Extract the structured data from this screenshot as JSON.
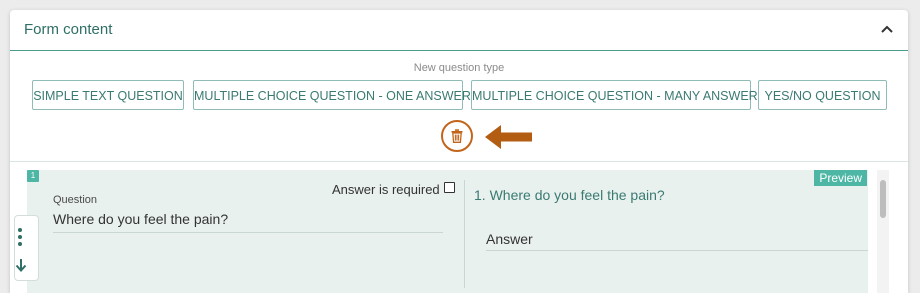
{
  "card": {
    "title": "Form content",
    "collapse_icon": "chevron-up-icon"
  },
  "new_question_type": {
    "label": "New question type",
    "buttons": [
      "SIMPLE TEXT QUESTION",
      "MULTIPLE CHOICE QUESTION - ONE ANSWER",
      "MULTIPLE CHOICE QUESTION - MANY ANSWERS",
      "YES/NO QUESTION"
    ]
  },
  "delete": {
    "icon": "trash-icon",
    "indicator": "arrow-left-icon",
    "color": "#c2651b"
  },
  "question": {
    "number": "1",
    "label": "Question",
    "value": "Where do you feel the pain?",
    "required_label": "Answer is required",
    "required": false,
    "preview_badge": "Preview",
    "preview_question": "1. Where do you feel the pain?",
    "preview_answer": "Answer"
  },
  "colors": {
    "accent": "#4db6a5",
    "text_accent": "#3a7a71",
    "panel_bg": "#e9f1ef"
  }
}
